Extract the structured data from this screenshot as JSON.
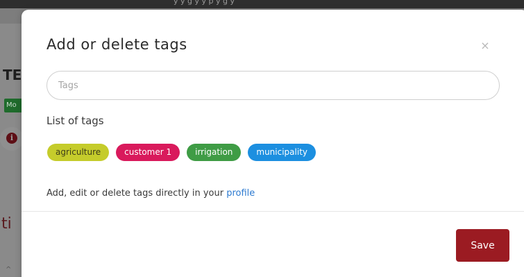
{
  "background": {
    "topbar_text": "y  y  g    y  y  p      y  g  y",
    "title_fragment": "TE",
    "badge_fragment": "Mo",
    "info_icon_glyph": "i",
    "section_fragment": "ti",
    "bottom_fragment": "^"
  },
  "modal": {
    "title": "Add or delete tags",
    "close_glyph": "×",
    "input": {
      "placeholder": "Tags",
      "value": ""
    },
    "list_label": "List of tags",
    "tags": [
      {
        "label": "agriculture",
        "bg": "#c5cc2b",
        "fg": "#3d3d1a"
      },
      {
        "label": "customer 1",
        "bg": "#d91a5c",
        "fg": "#ffffff"
      },
      {
        "label": "irrigation",
        "bg": "#3f9c45",
        "fg": "#ffffff"
      },
      {
        "label": "municipality",
        "bg": "#1c8fe0",
        "fg": "#ffffff"
      }
    ],
    "note_text": "Add, edit or delete tags directly in your ",
    "note_link": "profile",
    "save_label": "Save"
  },
  "colors": {
    "accent": "#9b1b22",
    "link": "#2c7ad0"
  }
}
